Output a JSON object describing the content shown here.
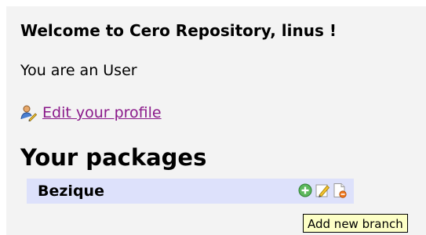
{
  "header": {
    "welcome": "Welcome to Cero Repository, linus !"
  },
  "user": {
    "role_text": "You are an User"
  },
  "profile": {
    "link_label": "Edit your profile",
    "icon": "user-edit-icon"
  },
  "packages": {
    "title": "Your packages",
    "items": [
      {
        "name": "Bezique",
        "actions": [
          {
            "icon": "add-branch-icon",
            "color": "#4caf50"
          },
          {
            "icon": "edit-icon",
            "color": "#f0b400"
          },
          {
            "icon": "delete-icon",
            "color": "#e05a00"
          }
        ]
      }
    ]
  },
  "tooltip": {
    "text": "Add new branch"
  },
  "colors": {
    "panel_bg": "#f3f3f3",
    "row_bg": "#dde1fb",
    "link": "#8a1a8a",
    "tooltip_bg": "#fdffc6"
  }
}
